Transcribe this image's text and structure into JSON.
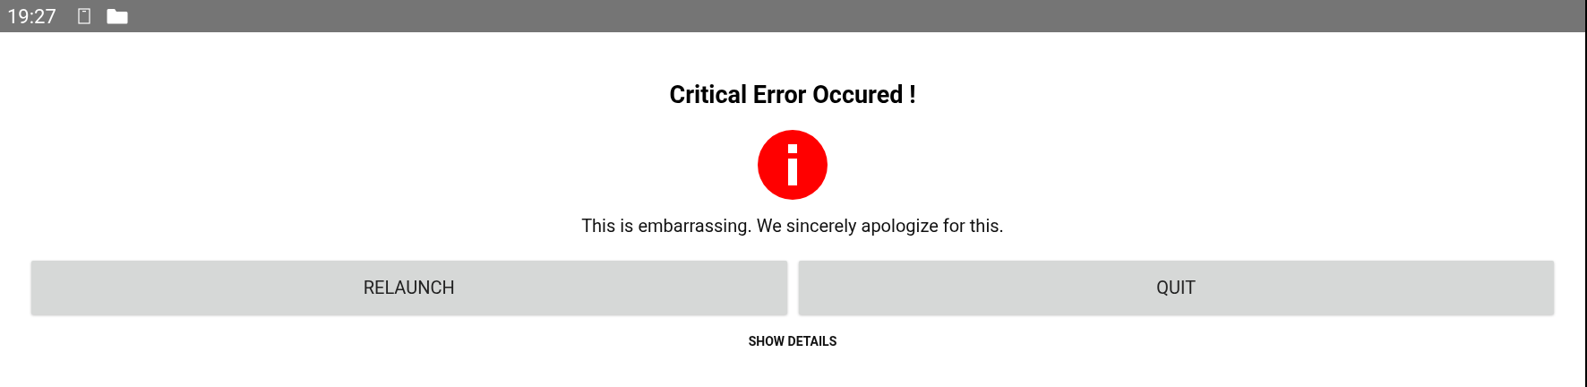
{
  "status_bar": {
    "time": "19:27"
  },
  "dialog": {
    "title": "Critical Error Occured !",
    "message": "This is embarrassing. We sincerely apologize for this.",
    "buttons": [
      "RELAUNCH",
      "QUIT"
    ],
    "link": "SHOW DETAILS"
  }
}
